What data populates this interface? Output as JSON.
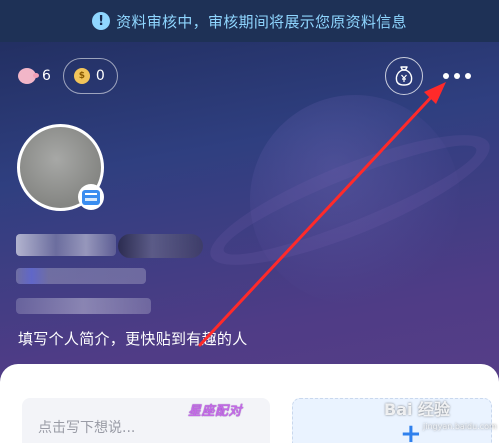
{
  "review_banner": {
    "icon": "info-icon",
    "text": "资料审核中，审核期间将展示您原资料信息",
    "color": "#8fd6ff"
  },
  "stats": {
    "likes_icon": "pig-icon",
    "likes_count": "6",
    "coins_icon": "coin-icon",
    "coins_count": "0"
  },
  "header_actions": {
    "wallet_icon": "money-bag-yen-icon",
    "more_icon": "more-dots-icon"
  },
  "profile": {
    "avatar": "avatar",
    "badge_icon": "card-badge-icon",
    "bio_prompt": "填写个人简介，更快贴到有趣的人"
  },
  "post": {
    "placeholder": "点击写下想说...",
    "tag": "星座配对",
    "add_icon": "+"
  },
  "watermark": {
    "text": "Bai 经验",
    "sub": "jingyan.baidu.com"
  },
  "annotation": {
    "color": "#ff2a2a"
  }
}
